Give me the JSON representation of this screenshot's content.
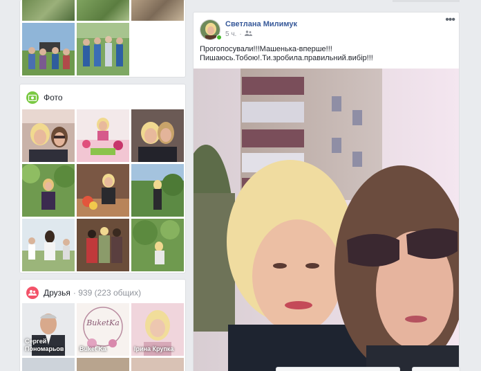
{
  "colors": {
    "link": "#365899",
    "photo_icon": "#7ac943",
    "friends_icon": "#f35369",
    "online": "#42b72a"
  },
  "photos_section": {
    "title": "Фото",
    "icon": "photo-icon"
  },
  "friends_section": {
    "title": "Друзья",
    "count": "· 939 (223 общих)",
    "icon": "friends-icon",
    "friends": [
      {
        "name": "Сергей Пономарьов"
      },
      {
        "name": "Buket Ka"
      },
      {
        "name": "Ірина Крупка"
      }
    ]
  },
  "post": {
    "author": "Светлана Милимук",
    "time": "5 ч.",
    "audience_icon": "friends-audience-icon",
    "more_icon": "more-options-icon",
    "more_label": "•••",
    "text_line1": "Прогопосували!!!Машенька-вперше!!!",
    "text_line2": "Пишаюсь.Тобою!.Ти.зробила.правильний.вибір!!!"
  }
}
